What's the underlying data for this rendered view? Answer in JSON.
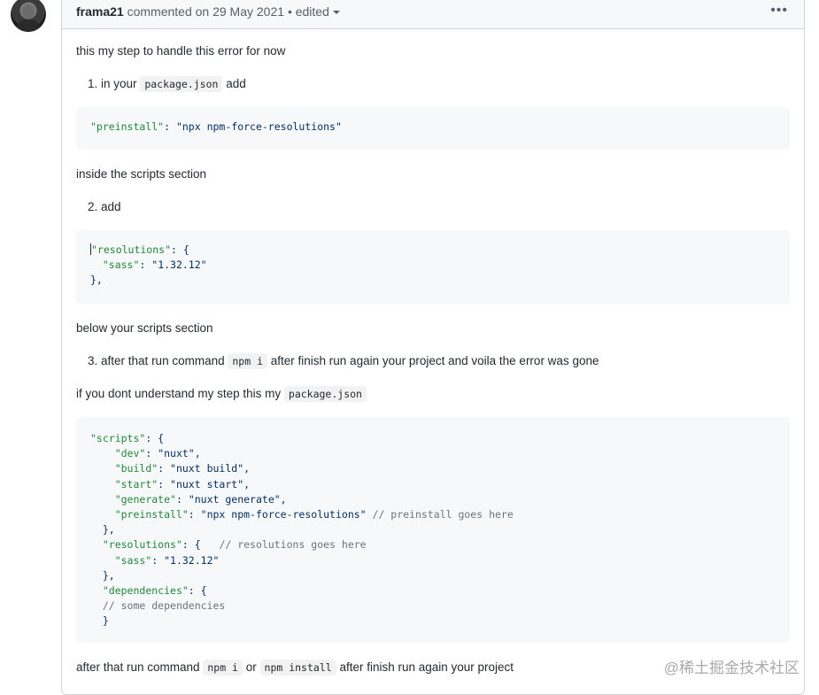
{
  "header": {
    "author": "frama21",
    "action": "commented on",
    "date": "29 May 2021",
    "separator": "•",
    "edited": "edited",
    "more": "•••"
  },
  "body": {
    "p1": "this my step to handle this error for now",
    "li1": {
      "number": "1.",
      "pre": "in your",
      "code": "package.json",
      "post": "add"
    },
    "code1": {
      "key": "\"preinstall\"",
      "punct": ": ",
      "value": "\"npx npm-force-resolutions\""
    },
    "p2": "inside the scripts section",
    "li2": {
      "number": "2.",
      "text": "add"
    },
    "code2": {
      "l1k": "\"resolutions\"",
      "l1p": ": {",
      "l2k": "\"sass\"",
      "l2p": ": ",
      "l2v": "\"1.32.12\"",
      "l3": "},"
    },
    "p3": "below your scripts section",
    "li3": {
      "number": "3.",
      "pre": "after that run command",
      "code": "npm i",
      "post": "after finish run again your project and voila the error was gone"
    },
    "p4": {
      "pre": "if you dont understand my step this my",
      "code": "package.json"
    },
    "code3": {
      "scripts_k": "\"scripts\"",
      "scripts_p": ": {",
      "dev_k": "\"dev\"",
      "dev_v": "\"nuxt\"",
      "build_k": "\"build\"",
      "build_v": "\"nuxt build\"",
      "start_k": "\"start\"",
      "start_v": "\"nuxt start\"",
      "generate_k": "\"generate\"",
      "generate_v": "\"nuxt generate\"",
      "pre_k": "\"preinstall\"",
      "pre_v": "\"npx npm-force-resolutions\"",
      "pre_c": "// preinstall goes here",
      "close1": "},",
      "res_k": "\"resolutions\"",
      "res_p": ": {",
      "res_c": "// resolutions goes here",
      "sass_k": "\"sass\"",
      "sass_v": "\"1.32.12\"",
      "close2": "},",
      "dep_k": "\"dependencies\"",
      "dep_p": ": {",
      "dep_c": "// some dependencies",
      "close3": "}"
    },
    "p5": {
      "pre": "after that run command",
      "code1": "npm i",
      "mid": "or",
      "code2": "npm install",
      "post": "after finish run again your project"
    }
  },
  "watermark": "@稀土掘金技术社区"
}
